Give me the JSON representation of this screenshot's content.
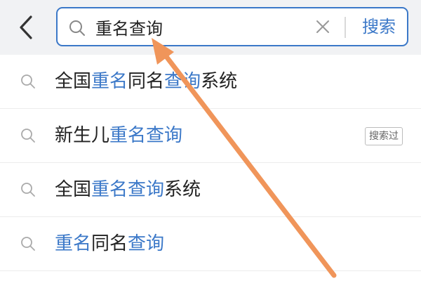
{
  "header": {
    "search": {
      "value": "重名查询",
      "button_label": "搜索"
    }
  },
  "suggestions": [
    {
      "parts": [
        {
          "text": "全国",
          "highlight": false
        },
        {
          "text": "重名",
          "highlight": true
        },
        {
          "text": "同名",
          "highlight": false
        },
        {
          "text": "查询",
          "highlight": true
        },
        {
          "text": "系统",
          "highlight": false
        }
      ]
    },
    {
      "parts": [
        {
          "text": "新生儿",
          "highlight": false
        },
        {
          "text": "重名查询",
          "highlight": true
        }
      ],
      "badge": "搜索过"
    },
    {
      "parts": [
        {
          "text": "全国",
          "highlight": false
        },
        {
          "text": "重名查询",
          "highlight": true
        },
        {
          "text": "系统",
          "highlight": false
        }
      ]
    },
    {
      "parts": [
        {
          "text": "重名",
          "highlight": true
        },
        {
          "text": "同名",
          "highlight": false
        },
        {
          "text": "查询",
          "highlight": true
        }
      ]
    }
  ],
  "colors": {
    "accent": "#3b78c8",
    "header_bg": "#f1f2f4",
    "annotation_arrow": "#f0955a"
  },
  "icons": {
    "back": "chevron-left-icon",
    "search": "search-icon",
    "clear": "close-icon",
    "suggestion": "search-icon",
    "annotation": "arrow-annotation"
  }
}
